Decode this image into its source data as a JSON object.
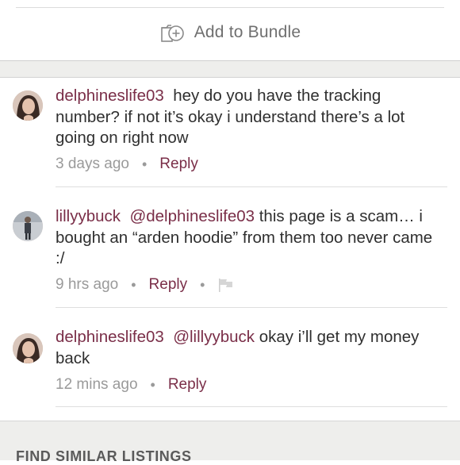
{
  "bundle": {
    "label": "Add to Bundle",
    "icon": "add-to-bundle-icon"
  },
  "comments": [
    {
      "username": "delphineslife03",
      "mention": "",
      "text": "hey do you have the tracking number? if not it’s okay i understand there’s a lot going on right now",
      "time": "3 days ago",
      "reply_label": "Reply",
      "show_flag": false
    },
    {
      "username": "lillyybuck",
      "mention": "@delphineslife03",
      "text": "this page is a scam… i bought an “arden hoodie” from them too never came :/",
      "time": "9 hrs ago",
      "reply_label": "Reply",
      "show_flag": true
    },
    {
      "username": "delphineslife03",
      "mention": "@lillyybuck",
      "text": "okay i’ll get my money back",
      "time": "12 mins ago",
      "reply_label": "Reply",
      "show_flag": false
    }
  ],
  "bottom_section": {
    "title": "FIND SIMILAR LISTINGS"
  },
  "colors": {
    "accent": "#7a2e48",
    "muted": "#9a9a9a",
    "band": "#eeeeec"
  }
}
